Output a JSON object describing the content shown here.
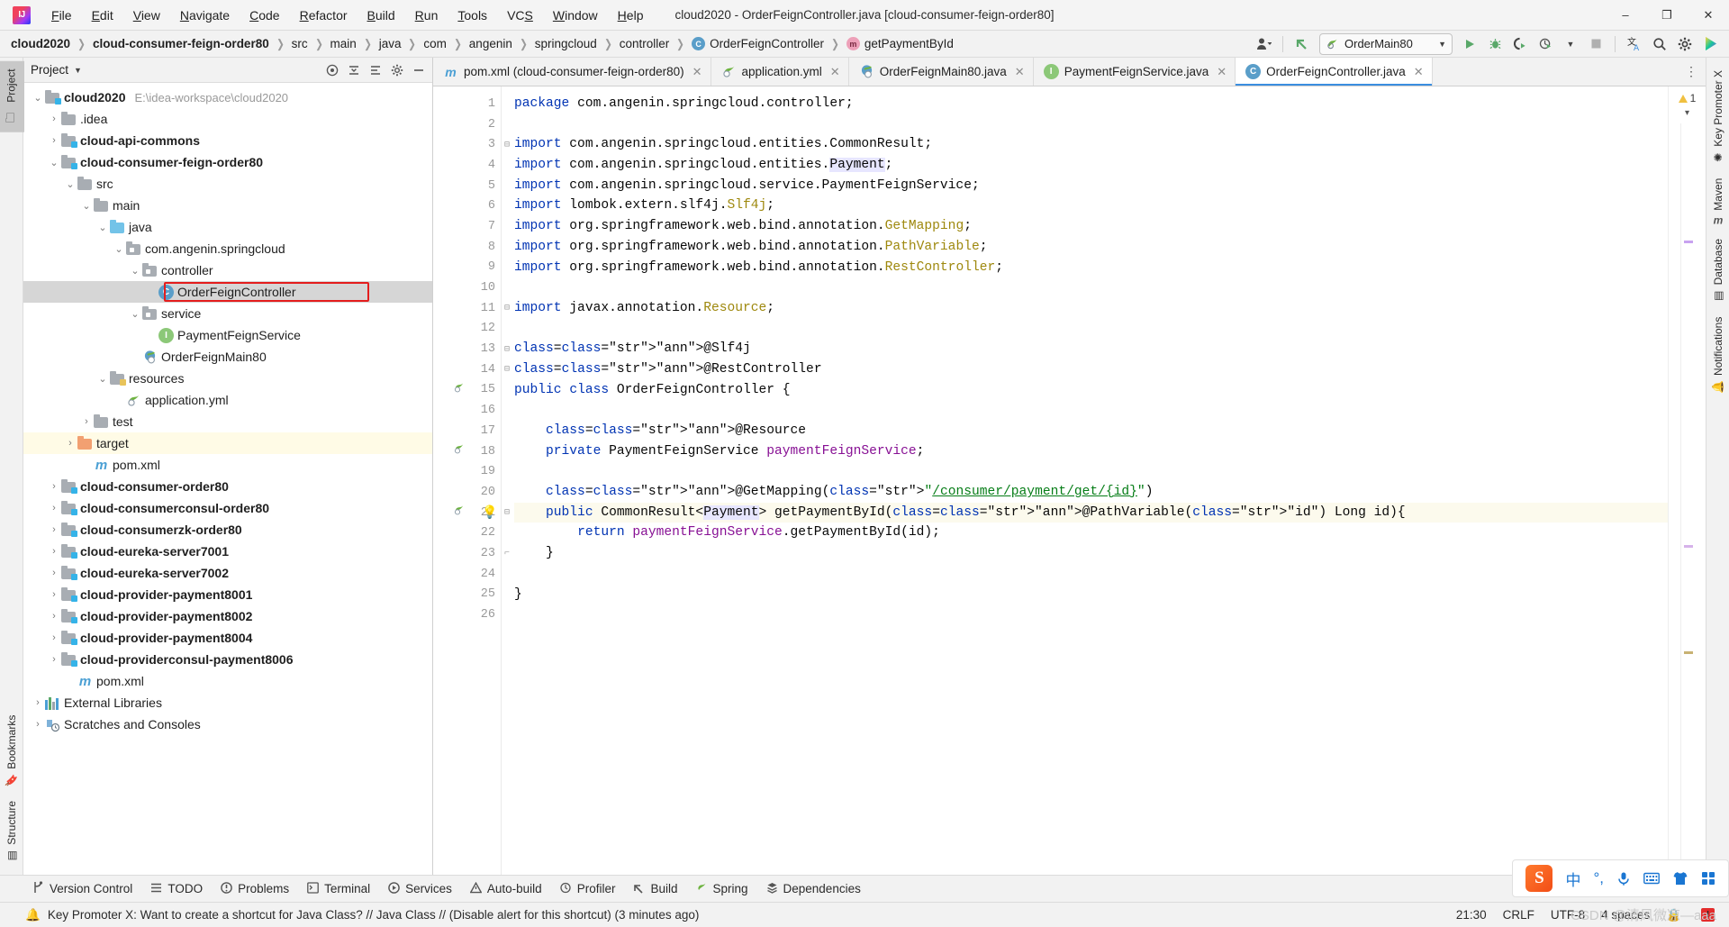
{
  "window": {
    "title": "cloud2020 - OrderFeignController.java [cloud-consumer-feign-order80]",
    "minimize": "–",
    "maximize": "❐",
    "close": "✕",
    "logo": "intellij-idea-logo"
  },
  "menu": [
    {
      "label": "File"
    },
    {
      "label": "Edit"
    },
    {
      "label": "View"
    },
    {
      "label": "Navigate"
    },
    {
      "label": "Code"
    },
    {
      "label": "Refactor"
    },
    {
      "label": "Build"
    },
    {
      "label": "Run"
    },
    {
      "label": "Tools"
    },
    {
      "label": "VCS"
    },
    {
      "label": "Window"
    },
    {
      "label": "Help"
    }
  ],
  "breadcrumbs": [
    {
      "label": "cloud2020",
      "bold": true,
      "icon": ""
    },
    {
      "label": "cloud-consumer-feign-order80",
      "bold": true,
      "icon": ""
    },
    {
      "label": "src",
      "bold": false,
      "icon": ""
    },
    {
      "label": "main",
      "bold": false,
      "icon": ""
    },
    {
      "label": "java",
      "bold": false,
      "icon": ""
    },
    {
      "label": "com",
      "bold": false,
      "icon": ""
    },
    {
      "label": "angenin",
      "bold": false,
      "icon": ""
    },
    {
      "label": "springcloud",
      "bold": false,
      "icon": ""
    },
    {
      "label": "controller",
      "bold": false,
      "icon": ""
    },
    {
      "label": "OrderFeignController",
      "bold": false,
      "icon": "class-icon",
      "iconLetter": "C"
    },
    {
      "label": "getPaymentById",
      "bold": false,
      "icon": "method-icon",
      "iconLetter": "m"
    }
  ],
  "toolbar": {
    "account_icon": "account-icon",
    "updates_icon": "updates-arrow-icon",
    "run_config": "OrderMain80",
    "run_config_icon": "spring-boot-icon",
    "dropdown_icon": "chevron-down-icon",
    "run_icon": "run-icon",
    "debug_icon": "debug-icon",
    "run_coverage_icon": "run-with-coverage-icon",
    "profiler_icon": "profiler-icon",
    "profiler_dropdown_icon": "chevron-down-icon",
    "stop_icon": "stop-icon",
    "translate_icon": "translate-icon",
    "search_icon": "search-everywhere-icon",
    "settings_icon": "gear-icon",
    "plugin_icon": "plugin-color-icon"
  },
  "left_strip": {
    "project": "Project",
    "bookmarks": "Bookmarks",
    "structure": "Structure"
  },
  "right_strip": {
    "key_promoter": "Key Promoter X",
    "maven": "Maven",
    "database": "Database",
    "notifications": "Notifications"
  },
  "project_panel": {
    "title": "Project",
    "title_chevron": "chevron-down-icon",
    "icons": [
      "target-icon",
      "collapse-all-icon",
      "expand-icon",
      "gear-icon",
      "hide-icon"
    ],
    "tree": [
      {
        "indent": 0,
        "twist": "v",
        "icon": "module-folder",
        "label": "cloud2020",
        "bold": true,
        "path": "E:\\idea-workspace\\cloud2020"
      },
      {
        "indent": 1,
        "twist": ">",
        "icon": "folder",
        "label": ".idea",
        "bold": false,
        "path": ""
      },
      {
        "indent": 1,
        "twist": ">",
        "icon": "module-folder",
        "label": "cloud-api-commons",
        "bold": true,
        "path": ""
      },
      {
        "indent": 1,
        "twist": "v",
        "icon": "module-folder",
        "label": "cloud-consumer-feign-order80",
        "bold": true,
        "path": ""
      },
      {
        "indent": 2,
        "twist": "v",
        "icon": "folder",
        "label": "src",
        "bold": false,
        "path": ""
      },
      {
        "indent": 3,
        "twist": "v",
        "icon": "folder",
        "label": "main",
        "bold": false,
        "path": ""
      },
      {
        "indent": 4,
        "twist": "v",
        "icon": "source-folder",
        "label": "java",
        "bold": false,
        "path": ""
      },
      {
        "indent": 5,
        "twist": "v",
        "icon": "package",
        "label": "com.angenin.springcloud",
        "bold": false,
        "path": ""
      },
      {
        "indent": 6,
        "twist": "v",
        "icon": "package",
        "label": "controller",
        "bold": false,
        "path": ""
      },
      {
        "indent": 7,
        "twist": "",
        "icon": "class",
        "label": "OrderFeignController",
        "bold": false,
        "path": "",
        "selected": true,
        "boxed": true
      },
      {
        "indent": 6,
        "twist": "v",
        "icon": "package",
        "label": "service",
        "bold": false,
        "path": ""
      },
      {
        "indent": 7,
        "twist": "",
        "icon": "interface",
        "label": "PaymentFeignService",
        "bold": false,
        "path": ""
      },
      {
        "indent": 6,
        "twist": "",
        "icon": "spring-class",
        "label": "OrderFeignMain80",
        "bold": false,
        "path": ""
      },
      {
        "indent": 4,
        "twist": "v",
        "icon": "resource-folder",
        "label": "resources",
        "bold": false,
        "path": ""
      },
      {
        "indent": 5,
        "twist": "",
        "icon": "spring-yml",
        "label": "application.yml",
        "bold": false,
        "path": ""
      },
      {
        "indent": 3,
        "twist": ">",
        "icon": "folder",
        "label": "test",
        "bold": false,
        "path": ""
      },
      {
        "indent": 2,
        "twist": ">",
        "icon": "target-folder",
        "label": "target",
        "bold": false,
        "path": "",
        "yellow": true
      },
      {
        "indent": 3,
        "twist": "",
        "icon": "maven",
        "label": "pom.xml",
        "bold": false,
        "path": ""
      },
      {
        "indent": 1,
        "twist": ">",
        "icon": "module-folder",
        "label": "cloud-consumer-order80",
        "bold": true,
        "path": ""
      },
      {
        "indent": 1,
        "twist": ">",
        "icon": "module-folder",
        "label": "cloud-consumerconsul-order80",
        "bold": true,
        "path": ""
      },
      {
        "indent": 1,
        "twist": ">",
        "icon": "module-folder",
        "label": "cloud-consumerzk-order80",
        "bold": true,
        "path": ""
      },
      {
        "indent": 1,
        "twist": ">",
        "icon": "module-folder",
        "label": "cloud-eureka-server7001",
        "bold": true,
        "path": ""
      },
      {
        "indent": 1,
        "twist": ">",
        "icon": "module-folder",
        "label": "cloud-eureka-server7002",
        "bold": true,
        "path": ""
      },
      {
        "indent": 1,
        "twist": ">",
        "icon": "module-folder",
        "label": "cloud-provider-payment8001",
        "bold": true,
        "path": ""
      },
      {
        "indent": 1,
        "twist": ">",
        "icon": "module-folder",
        "label": "cloud-provider-payment8002",
        "bold": true,
        "path": ""
      },
      {
        "indent": 1,
        "twist": ">",
        "icon": "module-folder",
        "label": "cloud-provider-payment8004",
        "bold": true,
        "path": ""
      },
      {
        "indent": 1,
        "twist": ">",
        "icon": "module-folder",
        "label": "cloud-providerconsul-payment8006",
        "bold": true,
        "path": ""
      },
      {
        "indent": 2,
        "twist": "",
        "icon": "maven",
        "label": "pom.xml",
        "bold": false,
        "path": ""
      },
      {
        "indent": 0,
        "twist": ">",
        "icon": "libraries",
        "label": "External Libraries",
        "bold": false,
        "path": ""
      },
      {
        "indent": 0,
        "twist": ">",
        "icon": "scratches",
        "label": "Scratches and Consoles",
        "bold": false,
        "path": ""
      }
    ]
  },
  "editor": {
    "tabs": [
      {
        "label": "pom.xml (cloud-consumer-feign-order80)",
        "icon": "maven-icon",
        "active": false
      },
      {
        "label": "application.yml",
        "icon": "spring-yml-icon",
        "active": false
      },
      {
        "label": "OrderFeignMain80.java",
        "icon": "spring-class-icon",
        "active": false
      },
      {
        "label": "PaymentFeignService.java",
        "icon": "interface-icon",
        "active": false
      },
      {
        "label": "OrderFeignController.java",
        "icon": "class-icon",
        "active": true
      }
    ],
    "tab_close": "✕",
    "tabs_more_icon": "more-tabs-icon",
    "warning_count": "1",
    "warning_icon": "warning-triangle-icon",
    "inspect_chevron": "chevron-down-icon",
    "line_numbers": [
      1,
      2,
      3,
      4,
      5,
      6,
      7,
      8,
      9,
      10,
      11,
      12,
      13,
      14,
      15,
      16,
      17,
      18,
      19,
      20,
      21,
      22,
      23,
      24,
      25,
      26
    ],
    "code_lines": [
      "package com.angenin.springcloud.controller;",
      "",
      "import com.angenin.springcloud.entities.CommonResult;",
      "import com.angenin.springcloud.entities.Payment;",
      "import com.angenin.springcloud.service.PaymentFeignService;",
      "import lombok.extern.slf4j.Slf4j;",
      "import org.springframework.web.bind.annotation.GetMapping;",
      "import org.springframework.web.bind.annotation.PathVariable;",
      "import org.springframework.web.bind.annotation.RestController;",
      "",
      "import javax.annotation.Resource;",
      "",
      "@Slf4j",
      "@RestController",
      "public class OrderFeignController {",
      "",
      "    @Resource",
      "    private PaymentFeignService paymentFeignService;",
      "",
      "    @GetMapping(\"/consumer/payment/get/{id}\")",
      "    public CommonResult<Payment> getPaymentById(@PathVariable(\"id\") Long id){",
      "        return paymentFeignService.getPaymentById(id);",
      "    }",
      "",
      "}",
      ""
    ]
  },
  "bottom_tools": [
    {
      "label": "Version Control",
      "icon": "branch-icon"
    },
    {
      "label": "TODO",
      "icon": "todo-list-icon"
    },
    {
      "label": "Problems",
      "icon": "problems-icon"
    },
    {
      "label": "Terminal",
      "icon": "terminal-icon"
    },
    {
      "label": "Services",
      "icon": "services-icon"
    },
    {
      "label": "Auto-build",
      "icon": "auto-build-icon"
    },
    {
      "label": "Profiler",
      "icon": "profiler-icon"
    },
    {
      "label": "Build",
      "icon": "build-hammer-icon"
    },
    {
      "label": "Spring",
      "icon": "spring-leaf-icon"
    },
    {
      "label": "Dependencies",
      "icon": "dependencies-icon"
    }
  ],
  "status": {
    "notification": "Key Promoter X: Want to create a shortcut for Java Class? // Java Class // (Disable alert for this shortcut) (3 minutes ago)",
    "notification_icon": "notification-bell-icon",
    "time": "21:30",
    "line_sep": "CRLF",
    "encoding": "UTF-8",
    "indent": "4 spaces",
    "lock_icon": "lock-icon",
    "inspection_icon": "inspection-icon"
  },
  "tray": {
    "sogou": "S",
    "chinese_mode": "中",
    "punctuation": "°,",
    "mic_icon": "microphone-icon",
    "keyboard_icon": "keyboard-icon",
    "skin_icon": "skin-icon",
    "apps_icon": "apps-grid-icon"
  },
  "watermark": "CSDN @清风微凉—aaa"
}
